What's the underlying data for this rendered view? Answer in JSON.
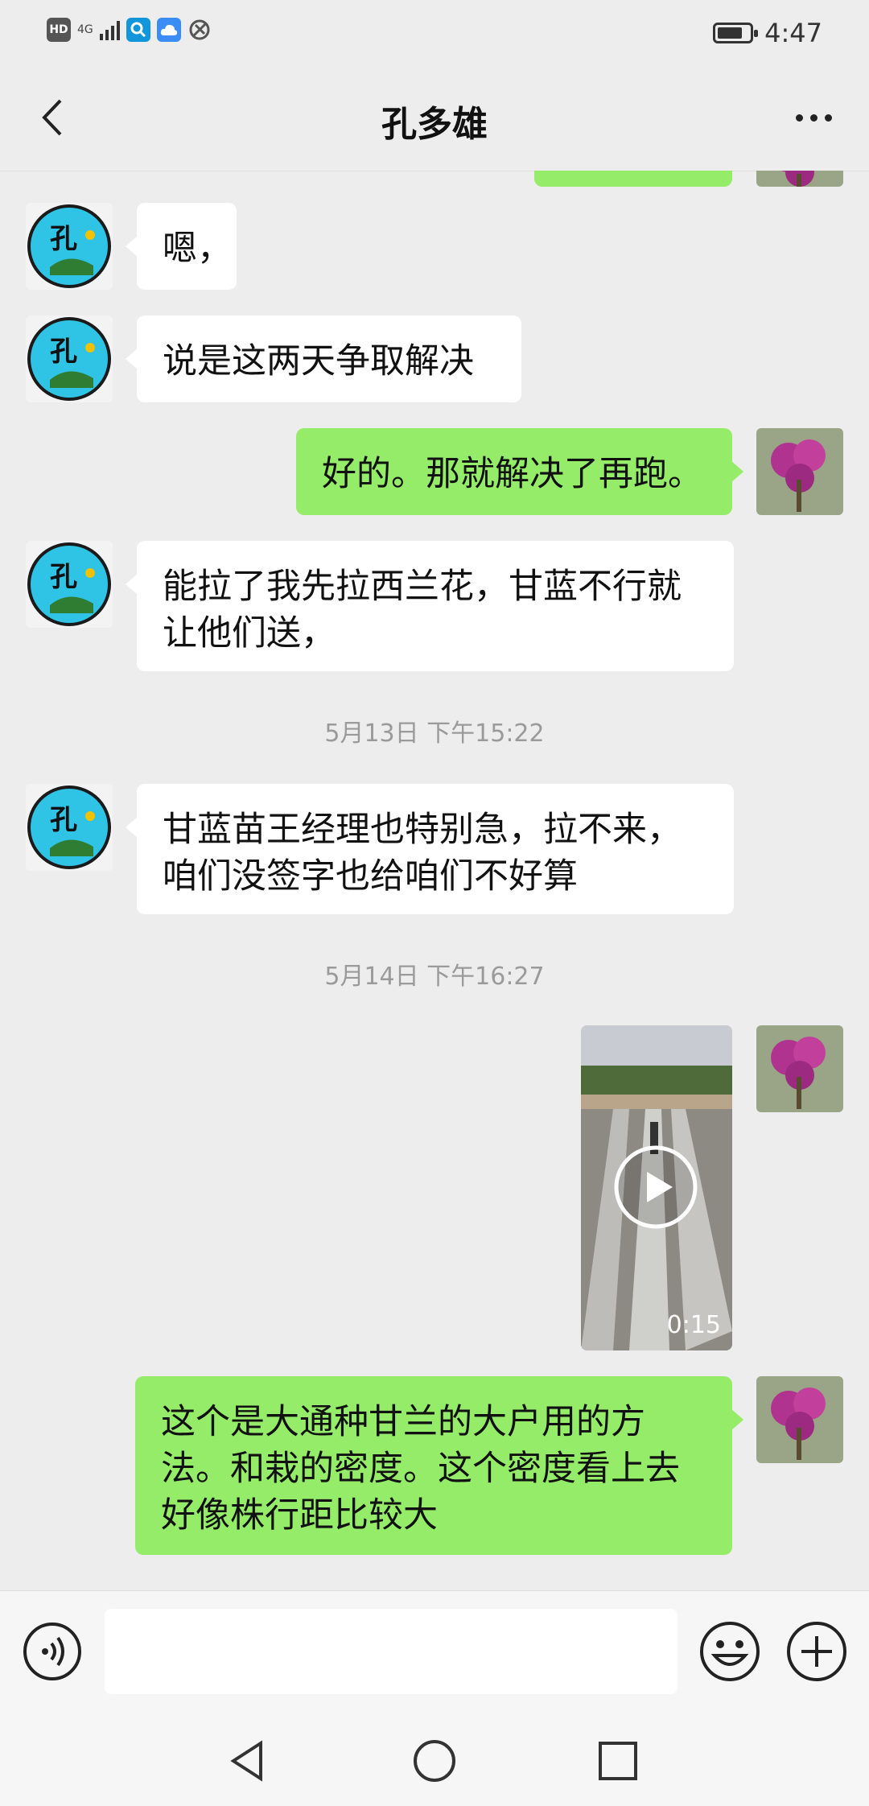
{
  "status_bar": {
    "hd": "HD",
    "network": "4G",
    "time": "4:47",
    "battery_level": 0.8
  },
  "header": {
    "title": "孔多雄"
  },
  "contact_avatar_text": "孔",
  "messages": [
    {
      "text": "嗯，"
    },
    {
      "text": "说是这两天争取解决"
    },
    {
      "text": "好的。那就解决了再跑。"
    },
    {
      "text": "能拉了我先拉西兰花，甘蓝不行就让他们送，"
    },
    {
      "text": "5月13日 下午15:22"
    },
    {
      "text": "甘蓝苗王经理也特别急，拉不来，咱们没签字也给咱们不好算"
    },
    {
      "text": "5月14日 下午16:27"
    },
    {
      "text": "0:15"
    },
    {
      "text": "这个是大通种甘兰的大户用的方法。和栽的密度。这个密度看上去好像株行距比较大"
    }
  ],
  "input": {
    "value": "",
    "placeholder": ""
  },
  "colors": {
    "sent_bubble": "#95ec69",
    "received_bubble": "#ffffff",
    "background": "#ededed"
  },
  "icons": [
    "back-icon",
    "more-icon",
    "voice-icon",
    "emoji-icon",
    "plus-icon",
    "nav-back-icon",
    "nav-home-icon",
    "nav-recent-icon",
    "play-icon"
  ]
}
